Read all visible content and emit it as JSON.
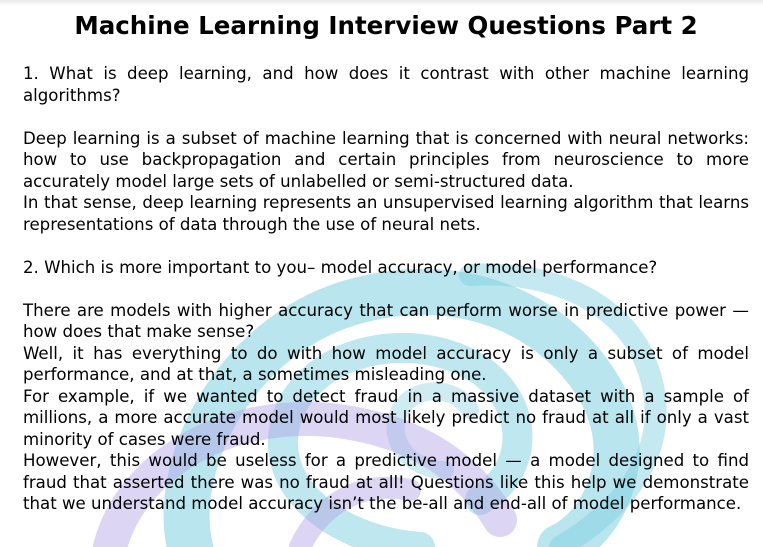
{
  "title": "Machine Learning Interview Questions Part 2",
  "q1": {
    "question": "1. What is deep learning, and how does it contrast with other machine learning algorithms?",
    "answer": [
      "Deep learning is a subset of machine learning that is concerned with neural networks: how to use backpropagation and certain principles from neuroscience to more accurately model large sets of unlabelled or semi-structured data.",
      "In that sense, deep learning represents an unsupervised learning algorithm that learns representations of data through the use of neural nets."
    ]
  },
  "q2": {
    "question": "2. Which is more important to you– model accuracy, or model performance?",
    "answer": [
      "There are models with higher accuracy that can perform worse in predictive power — how does that make sense?",
      "Well, it has everything to do with how model accuracy is only a subset of model performance, and at that, a sometimes misleading one.",
      "For example, if we wanted to detect fraud in a massive dataset with a sample of millions, a more accurate model would most likely predict no fraud at all if only a vast minority of cases were fraud.",
      "However, this would be useless for a predictive model — a model designed to find fraud that asserted there was no fraud at all! Questions like this help we demonstrate that we understand model accuracy isn’t the be-all and end-all of model performance."
    ]
  },
  "watermark": {
    "colors": [
      "#7ecfe0",
      "#b2a2e6"
    ]
  }
}
